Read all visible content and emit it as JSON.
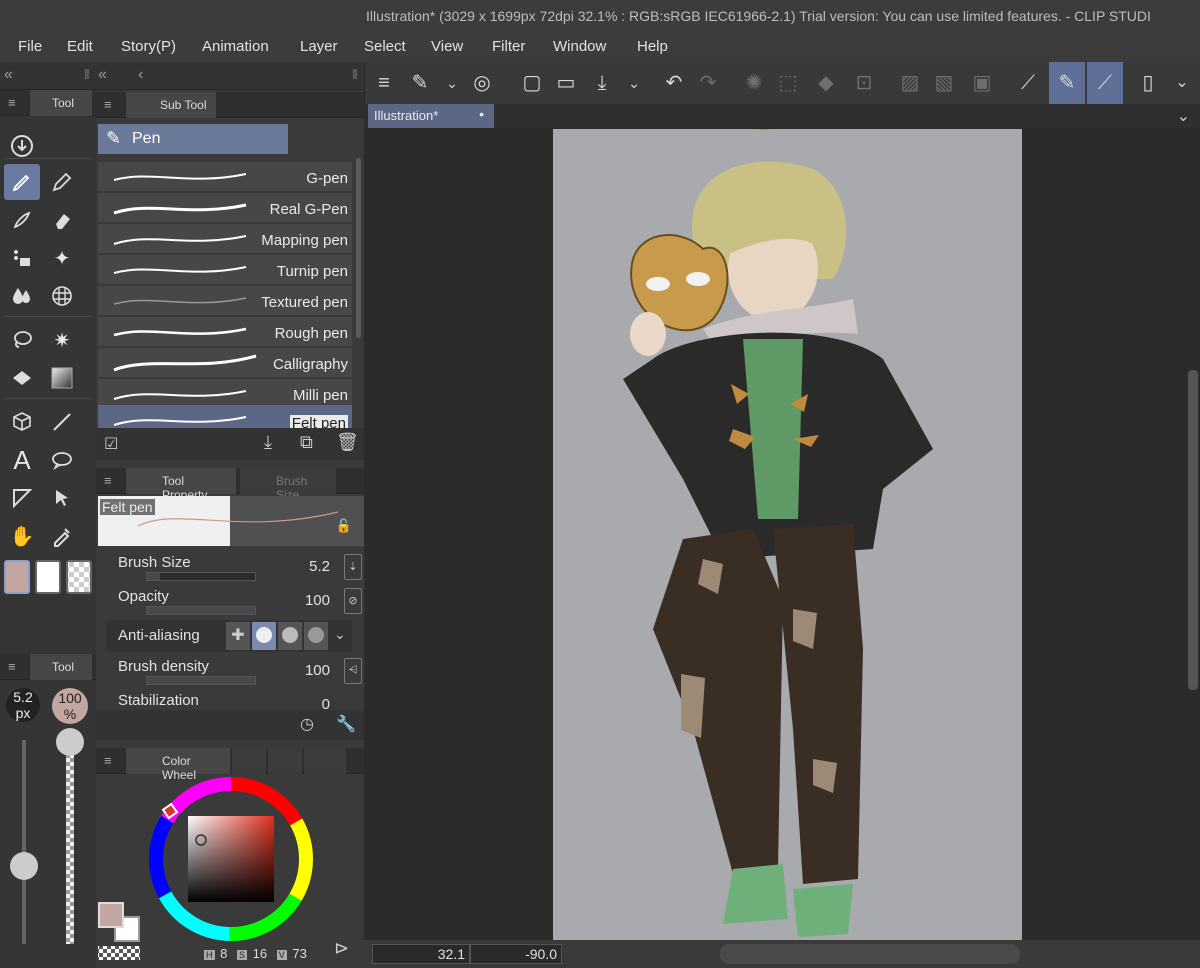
{
  "window": {
    "title": "Illustration* (3029 x 1699px 72dpi 32.1% : RGB:sRGB IEC61966-2.1)  Trial version: You can use limited features. - CLIP STUDI"
  },
  "menu": [
    "File",
    "Edit",
    "Story(P)",
    "Animation",
    "Layer",
    "Select",
    "View",
    "Filter",
    "Window",
    "Help"
  ],
  "tool_panel": {
    "tab_label": "Tool",
    "tools": [
      "download-icon",
      "pen-icon",
      "pencil-icon",
      "brush-icon",
      "eraser-icon",
      "decoration-icon",
      "sparkle-icon",
      "blend-icon",
      "grid-icon",
      "lasso-icon",
      "magic-wand-icon",
      "fill-icon",
      "gradient-icon",
      "3d-select-icon",
      "line-icon",
      "text-icon",
      "speech-bubble-icon",
      "ruler-icon",
      "operation-icon",
      "hand-icon",
      "eyedropper-icon"
    ],
    "active_tool": "pen-icon"
  },
  "color_swatches": {
    "main": "#c4a6a0",
    "sub": "#ffffff"
  },
  "subtool_panel": {
    "tab_label": "Sub Tool",
    "group": "Pen",
    "items": [
      "G-pen",
      "Real G-Pen",
      "Mapping pen",
      "Turnip pen",
      "Textured pen",
      "Rough pen",
      "Calligraphy",
      "Milli pen",
      "Felt pen"
    ],
    "selected": "Felt pen"
  },
  "tool_property": {
    "tab_label": "Tool Property",
    "tab2_label": "Brush Size",
    "preview_label": "Felt pen",
    "brush_size_label": "Brush Size",
    "brush_size": "5.2",
    "opacity_label": "Opacity",
    "opacity": "100",
    "anti_aliasing_label": "Anti-aliasing",
    "brush_density_label": "Brush density",
    "brush_density": "100",
    "stabilization_label": "Stabilization",
    "stabilization": "0"
  },
  "brush_size_palette": {
    "tab_label": "Tool",
    "size": "5.2",
    "size_unit": "px",
    "opacity": "100",
    "opacity_unit": "%"
  },
  "color_wheel": {
    "tab_label": "Color Wheel",
    "h_tag": "H",
    "h": "8",
    "s_tag": "S",
    "s": "16",
    "v_tag": "V",
    "v": "73"
  },
  "document": {
    "tab_label": "Illustration*"
  },
  "status": {
    "zoom": "32.1",
    "rotation": "-90.0"
  }
}
